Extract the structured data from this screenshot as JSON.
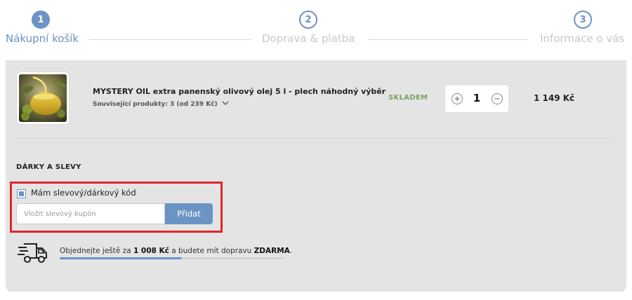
{
  "steps": [
    {
      "number": "1",
      "label": "Nákupní košík",
      "active": true
    },
    {
      "number": "2",
      "label": "Doprava & platba",
      "active": false
    },
    {
      "number": "3",
      "label": "Informace o vás",
      "active": false
    }
  ],
  "cart": {
    "item": {
      "image": "olive-oil-product-photo",
      "name": "MYSTERY OIL extra panenský olivový olej 5 l - plech náhodný výběr",
      "related": "Související produkty: 3 (od 239 Kč)",
      "stock": "SKLADEM",
      "quantity": "1",
      "price": "1 149 Kč"
    }
  },
  "discounts": {
    "title": "DÁRKY A SLEVY",
    "checkbox_label": "Mám slevový/dárkový kód",
    "checkbox_checked": true,
    "input_placeholder": "Vložit slevový kupón",
    "input_value": "",
    "button_label": "Přidat"
  },
  "shipping": {
    "icon": "delivery-truck-icon",
    "text_before": "Objednejte ještě za ",
    "amount": "1 008 Kč",
    "text_middle": " a budete mít dopravu ",
    "free_word": "ZDARMA",
    "text_after": ".",
    "progress": 0.54
  },
  "colors": {
    "accent": "#6b93c4",
    "stock": "#7fa067",
    "highlight": "#e0262b",
    "panel": "#e4e4e4"
  }
}
